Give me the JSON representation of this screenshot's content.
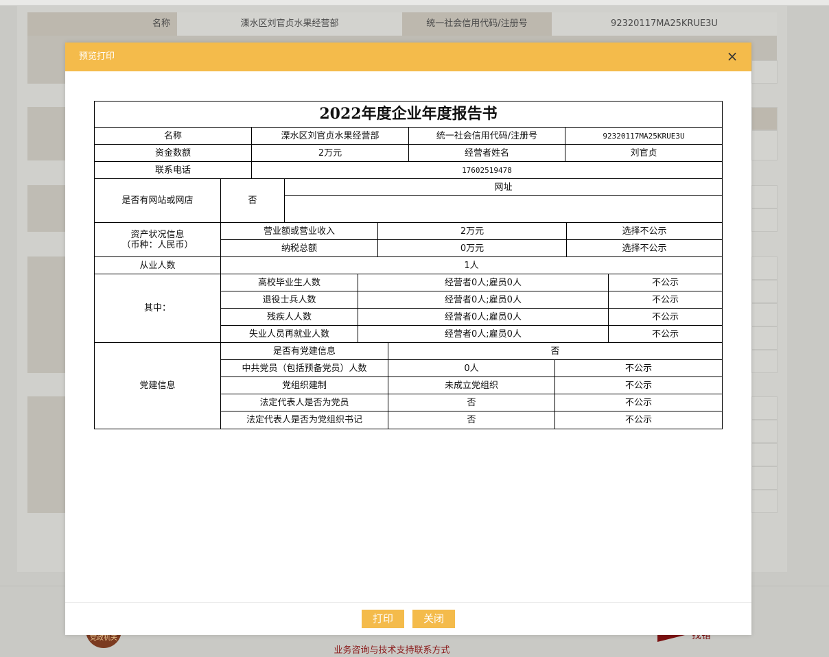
{
  "background": {
    "row1": {
      "name_label": "名称",
      "name_value": "溧水区刘官贞水果经营部",
      "code_label": "统一社会信用代码/注册号",
      "code_value": "92320117MA25KRUE3U"
    },
    "footer_link": "业务咨询与技术支持联系方式",
    "badge_text": "党政机关",
    "corner_text": "找错"
  },
  "modal": {
    "title": "预览打印",
    "close_glyph": "×",
    "print_button": "打印",
    "close_button": "关闭"
  },
  "report": {
    "title": "2022年度企业年度报告书",
    "basic": {
      "name_label": "名称",
      "name_value": "溧水区刘官贞水果经营部",
      "code_label": "统一社会信用代码/注册号",
      "code_value": "92320117MA25KRUE3U",
      "capital_label": "资金数额",
      "capital_value": "2万元",
      "operator_label": "经营者姓名",
      "operator_value": "刘官贞",
      "phone_label": "联系电话",
      "phone_value": "17602519478"
    },
    "website": {
      "label": "是否有网站或网店",
      "value": "否",
      "url_header": "网址",
      "url_value": ""
    },
    "assets": {
      "label_line1": "资产状况信息",
      "label_line2": "（币种：人民币）",
      "rows": [
        {
          "item": "营业额或营业收入",
          "value": "2万元",
          "status": "选择不公示"
        },
        {
          "item": "纳税总额",
          "value": "0万元",
          "status": "选择不公示"
        }
      ]
    },
    "employees": {
      "label": "从业人数",
      "value": "1人"
    },
    "among": {
      "label": "其中：",
      "rows": [
        {
          "item": "高校毕业生人数",
          "value": "经营者0人;雇员0人",
          "status": "不公示"
        },
        {
          "item": "退役士兵人数",
          "value": "经营者0人;雇员0人",
          "status": "不公示"
        },
        {
          "item": "残疾人人数",
          "value": "经营者0人;雇员0人",
          "status": "不公示"
        },
        {
          "item": "失业人员再就业人数",
          "value": "经营者0人;雇员0人",
          "status": "不公示"
        }
      ]
    },
    "party": {
      "label": "党建信息",
      "has_party_label": "是否有党建信息",
      "has_party_value": "否",
      "rows": [
        {
          "item": "中共党员（包括预备党员）人数",
          "value": "0人",
          "status": "不公示"
        },
        {
          "item": "党组织建制",
          "value": "未成立党组织",
          "status": "不公示"
        },
        {
          "item": "法定代表人是否为党员",
          "value": "否",
          "status": "不公示"
        },
        {
          "item": "法定代表人是否为党组织书记",
          "value": "否",
          "status": "不公示"
        }
      ]
    }
  }
}
